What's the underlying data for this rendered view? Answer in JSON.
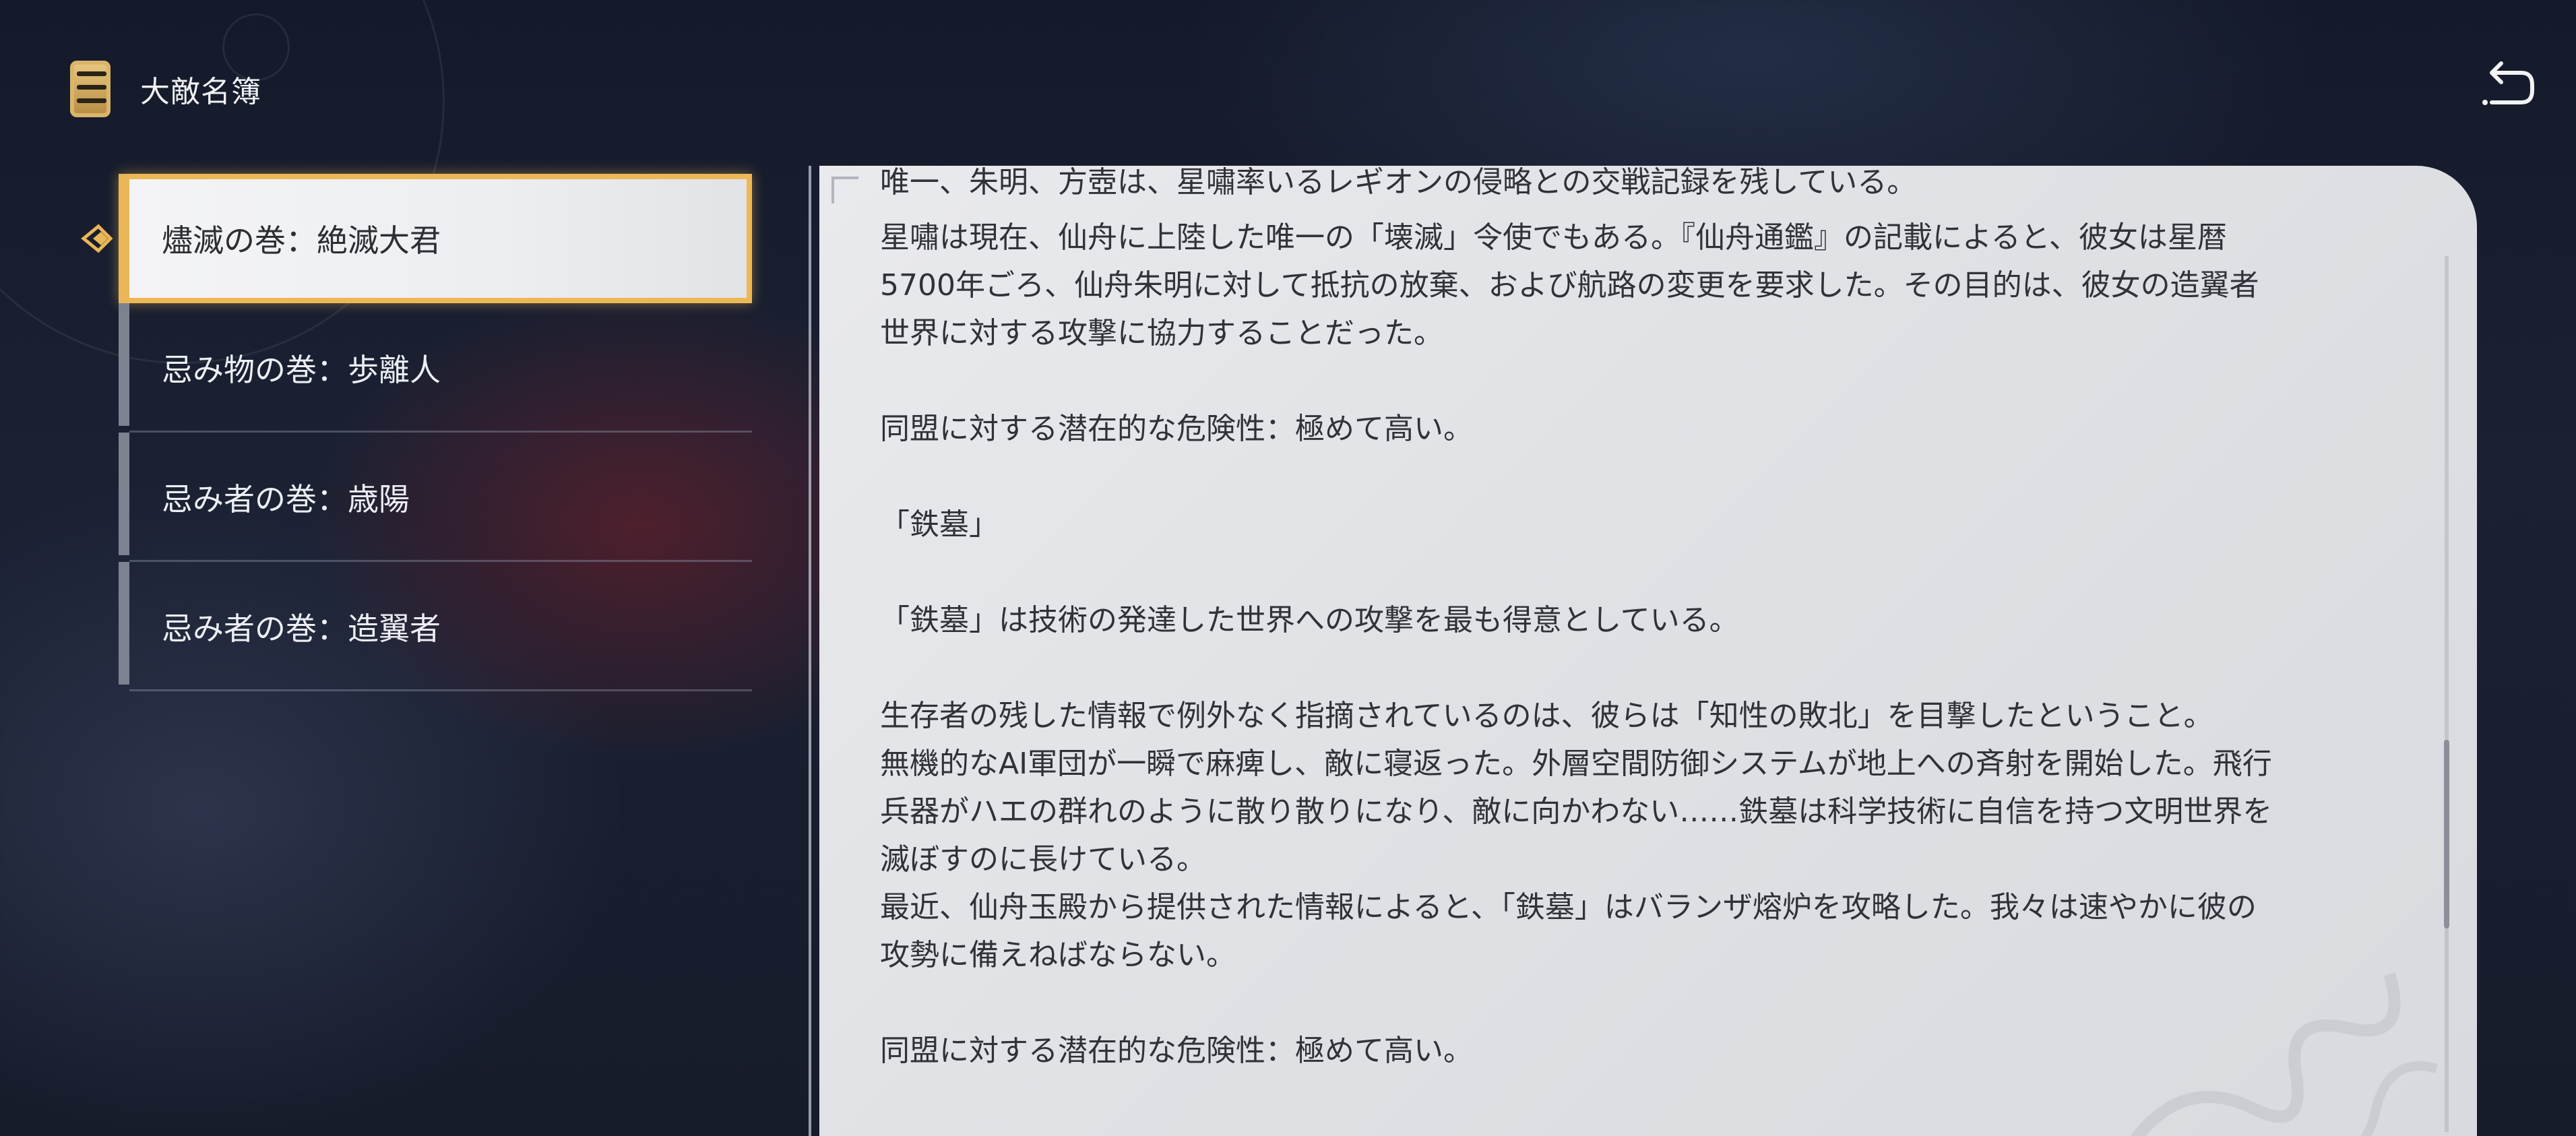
{
  "header": {
    "title": "大敵名簿",
    "book_icon": "book-icon",
    "back_icon": "return-arrow-icon"
  },
  "list": {
    "items": [
      {
        "label": "燼滅の巻：絶滅大君",
        "selected": true
      },
      {
        "label": "忌み物の巻：歩離人",
        "selected": false
      },
      {
        "label": "忌み者の巻：歳陽",
        "selected": false
      },
      {
        "label": "忌み者の巻：造翼者",
        "selected": false
      }
    ]
  },
  "content": {
    "lines": [
      "唯一、朱明、方壺は、星嘯率いるレギオンの侵略との交戦記録を残している。",
      "星嘯は現在、仙舟に上陸した唯一の「壊滅」令使でもある。『仙舟通鑑』の記載によると、彼女は星暦",
      "5700年ごろ、仙舟朱明に対して抵抗の放棄、および航路の変更を要求した。その目的は、彼女の造翼者",
      "世界に対する攻撃に協力することだった。",
      "",
      "同盟に対する潜在的な危険性：極めて高い。",
      "",
      "「鉄墓」",
      "",
      "「鉄墓」は技術の発達した世界への攻撃を最も得意としている。",
      "",
      "生存者の残した情報で例外なく指摘されているのは、彼らは「知性の敗北」を目撃したということ。",
      "無機的なAI軍団が一瞬で麻痺し、敵に寝返った。外層空間防御システムが地上への斉射を開始した。飛行",
      "兵器がハエの群れのように散り散りになり、敵に向かわない……鉄墓は科学技術に自信を持つ文明世界を",
      "滅ぼすのに長けている。",
      "最近、仙舟玉殿から提供された情報によると、「鉄墓」はバランザ熔炉を攻略した。我々は速やかに彼の",
      "攻勢に備えねばならない。",
      "",
      "同盟に対する潜在的な危険性：極めて高い。"
    ]
  },
  "colors": {
    "accent": "#eeb755",
    "panel": "#e2e3e7",
    "text_dark": "#2f3238",
    "text_light": "#eceef3"
  }
}
